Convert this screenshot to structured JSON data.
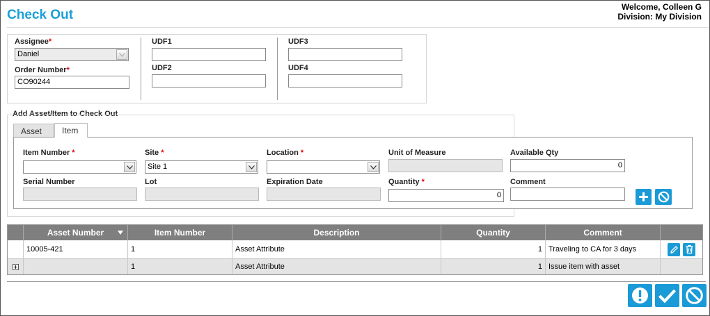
{
  "header": {
    "title": "Check Out",
    "welcome": "Welcome, Colleen G",
    "division": "Division: My Division"
  },
  "form": {
    "assignee_label": "Assignee",
    "assignee_value": "Daniel",
    "order_label": "Order Number",
    "order_value": "CO90244",
    "udf1_label": "UDF1",
    "udf2_label": "UDF2",
    "udf3_label": "UDF3",
    "udf4_label": "UDF4",
    "required_mark": "*"
  },
  "add_section": {
    "legend": "Add Asset/Item to Check Out",
    "tabs": [
      "Asset",
      "Item"
    ],
    "active_tab": "Item",
    "item_number_label": "Item Number",
    "item_number_value": "",
    "site_label": "Site",
    "site_value": "Site 1",
    "location_label": "Location",
    "location_value": "",
    "uom_label": "Unit of Measure",
    "available_qty_label": "Available Qty",
    "available_qty_value": "0",
    "serial_label": "Serial Number",
    "lot_label": "Lot",
    "expiration_label": "Expiration Date",
    "quantity_label": "Quantity",
    "quantity_value": "0",
    "comment_label": "Comment",
    "add_icon": "plus-icon",
    "clear_icon": "cancel-icon"
  },
  "grid": {
    "columns": [
      "Asset Number",
      "Item Number",
      "Description",
      "Quantity",
      "Comment"
    ],
    "rows": [
      {
        "asset_number": "10005-421",
        "item_number": "1",
        "description": "Asset Attribute",
        "quantity": "1",
        "comment": "Traveling to CA for 3 days"
      },
      {
        "asset_number": "",
        "item_number": "1",
        "description": "Asset Attribute",
        "quantity": "1",
        "comment": "Issue item with asset"
      }
    ]
  },
  "colors": {
    "accent": "#1a9ad6",
    "grid_header": "#7f7f7f",
    "required": "#dd0000"
  }
}
